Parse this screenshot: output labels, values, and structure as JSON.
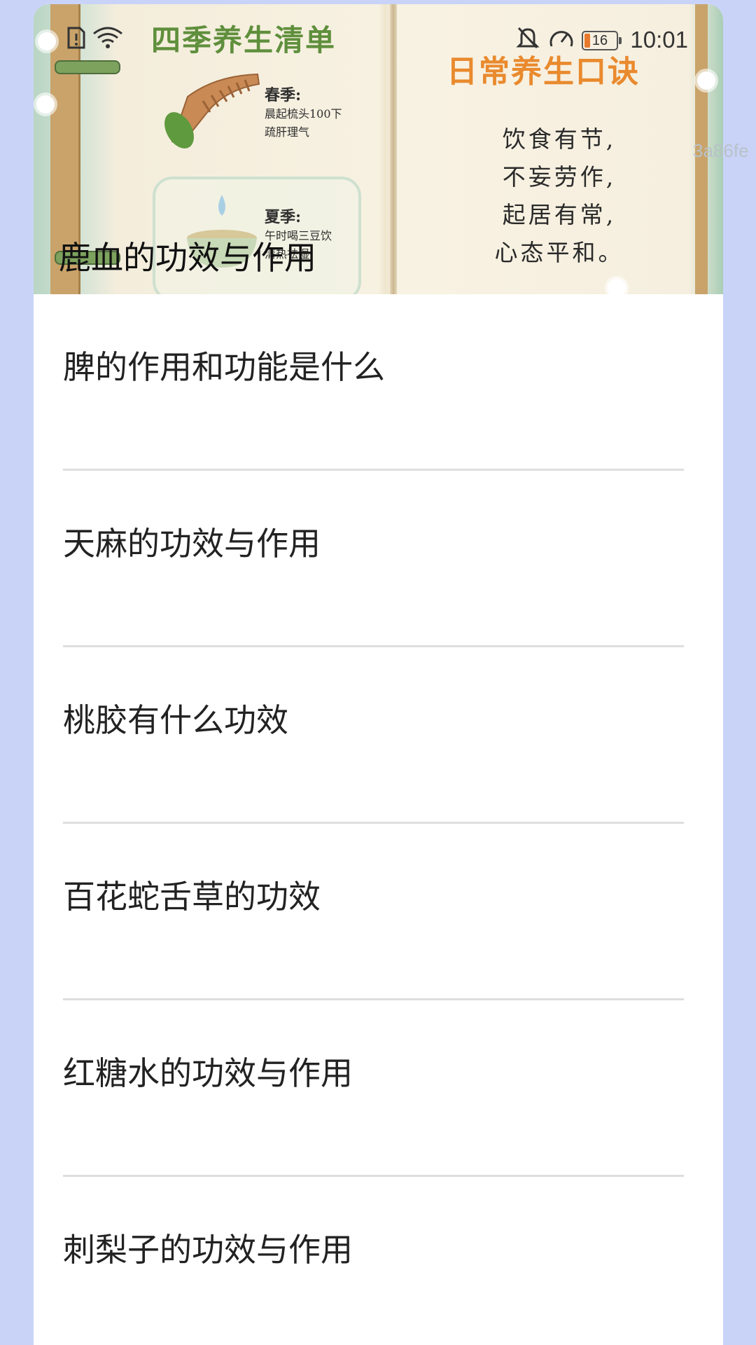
{
  "status_bar": {
    "time": "10:01",
    "battery": "16",
    "icons": [
      "alert-sim-icon",
      "wifi-icon",
      "bell-muted-icon",
      "speed-icon",
      "battery-icon"
    ]
  },
  "banner": {
    "heading_left": "四季养生清单",
    "heading_right": "日常养生口诀",
    "spring_title": "春季:",
    "spring_line1": "晨起梳头100下",
    "spring_line2": "疏肝理气",
    "summer_title": "夏季:",
    "summer_line1": "午时喝三豆饮",
    "summer_line2": "清热祛湿",
    "verse": [
      "饮食有节,",
      "不妄劳作,",
      "起居有常,",
      "心态平和。"
    ],
    "title": "鹿血的功效与作用",
    "ghost_text": "3a86fe"
  },
  "list": {
    "items": [
      {
        "label": "脾的作用和功能是什么"
      },
      {
        "label": "天麻的功效与作用"
      },
      {
        "label": "桃胶有什么功效"
      },
      {
        "label": "百花蛇舌草的功效"
      },
      {
        "label": "红糖水的功效与作用"
      },
      {
        "label": "刺梨子的功效与作用"
      }
    ]
  },
  "colors": {
    "page_background": "#c9d3f8",
    "card_background": "#ffffff",
    "heading_green": "#5f8f3c",
    "heading_orange": "#e98a2e",
    "divider": "#dedede"
  }
}
